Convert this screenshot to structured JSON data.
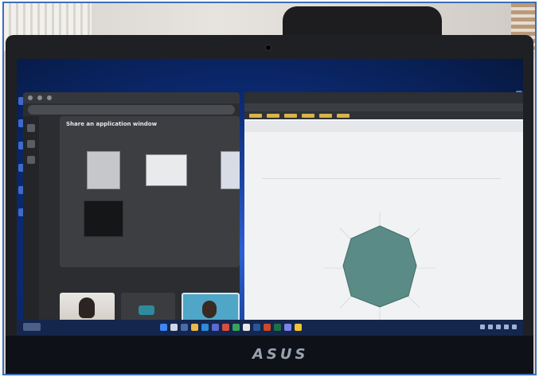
{
  "photo": {
    "brand_logo": "ASUS"
  },
  "meet_window": {
    "share_title": "Share an application window",
    "share_subtitle": "",
    "thumb_captions": [
      "",
      "",
      "",
      ""
    ]
  },
  "chart_browser": {
    "chart_title": "",
    "chart_value": "",
    "chart_type": "radar"
  },
  "colors": {
    "screen_wallpaper": "#0b2a72",
    "radar_fill": "#5b8b87",
    "end_call": "#e2483c"
  }
}
